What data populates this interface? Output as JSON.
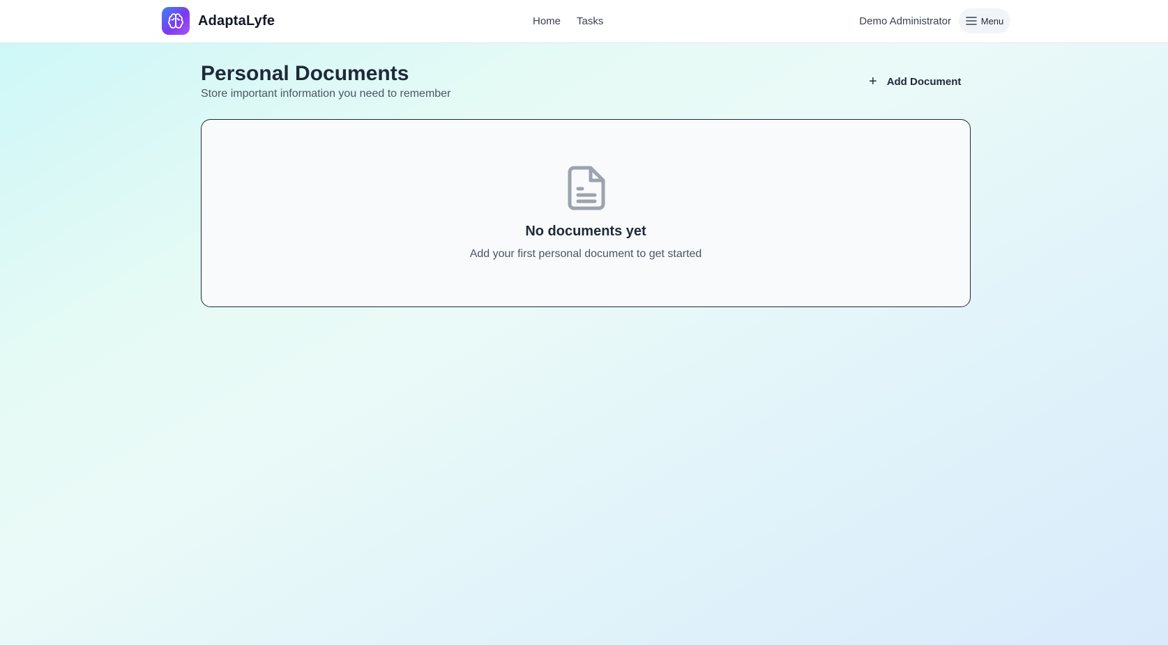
{
  "app": {
    "name": "AdaptaLyfe",
    "logo_icon": "brain-icon"
  },
  "nav": {
    "links": [
      "Home",
      "Tasks"
    ],
    "user_name": "Demo Administrator",
    "menu_label": "Menu",
    "menu_icon": "hamburger-icon"
  },
  "page": {
    "title": "Personal Documents",
    "subtitle": "Store important information you need to remember",
    "add_button_label": "Add Document",
    "add_button_icon": "plus-icon"
  },
  "empty_state": {
    "icon": "document-icon",
    "title": "No documents yet",
    "text": "Add your first personal document to get started"
  },
  "colors": {
    "brand_gradient_start": "#3b82f6",
    "brand_gradient_end": "#a855f7",
    "background_start": "#cbf7f8",
    "background_end": "#d9eafb"
  }
}
